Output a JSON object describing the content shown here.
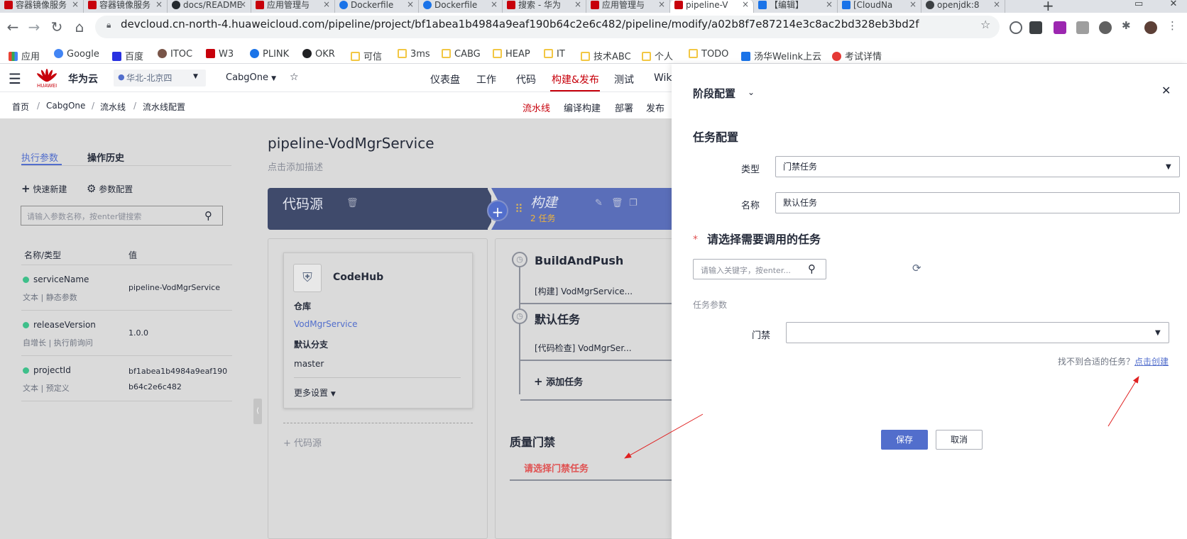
{
  "browser": {
    "tabs": [
      {
        "label": "容器镜像服务",
        "color": "#c7000b"
      },
      {
        "label": "容器镜像服务",
        "color": "#c7000b"
      },
      {
        "label": "docs/README",
        "color": "#24292e"
      },
      {
        "label": "应用管理与",
        "color": "#c7000b"
      },
      {
        "label": "Dockerfile",
        "color": "#1a73e8"
      },
      {
        "label": "Dockerfile",
        "color": "#1a73e8"
      },
      {
        "label": "搜索 - 华为",
        "color": "#c7000b"
      },
      {
        "label": "应用管理与",
        "color": "#c7000b"
      },
      {
        "label": "pipeline-V",
        "color": "#c7000b"
      },
      {
        "label": "【编辑】",
        "color": "#1a73e8"
      },
      {
        "label": "[CloudNa",
        "color": "#1a73e8"
      },
      {
        "label": "openjdk:8",
        "color": "#3c4043"
      }
    ],
    "new_tab": "+",
    "url": "devcloud.cn-north-4.huaweicloud.com/pipeline/project/bf1abea1b4984a9eaf190b64c2e6c482/pipeline/modify/a02b8f7e87214e3c8ac2bd328eb3bd2f",
    "bookmarks": [
      "应用",
      "Google",
      "百度",
      "ITOC",
      "W3",
      "PLINK",
      "OKR",
      "可信",
      "3ms",
      "CABG",
      "HEAP",
      "IT",
      "技术ABC",
      "个人",
      "TODO",
      "汤华Welink上云",
      "考试详情"
    ]
  },
  "header": {
    "brand": "华为云",
    "logo_text": "HUAWEI",
    "region": "华北-北京四",
    "project": "CabgOne",
    "nav": [
      "仪表盘",
      "工作",
      "代码",
      "构建&发布",
      "测试",
      "Wiki"
    ],
    "active_nav": "构建&发布"
  },
  "subheader": {
    "breadcrumb": [
      "首页",
      "CabgOne",
      "流水线",
      "流水线配置"
    ],
    "separator": "/",
    "subnav": [
      "流水线",
      "编译构建",
      "部署",
      "发布"
    ]
  },
  "left_panel": {
    "tabs": [
      "执行参数",
      "操作历史"
    ],
    "actions": [
      "快速新建",
      "参数配置"
    ],
    "search_placeholder": "请输入参数名称，按enter键搜索",
    "columns": [
      "名称/类型",
      "值"
    ],
    "params": [
      {
        "name": "serviceName",
        "type": "文本 | 静态参数",
        "value": "pipeline-VodMgrService",
        "value2": ""
      },
      {
        "name": "releaseVersion",
        "type": "自增长 | 执行前询问",
        "value": "1.0.0",
        "value2": ""
      },
      {
        "name": "projectId",
        "type": "文本 | 预定义",
        "value": "bf1abea1b4984a9eaf190",
        "value2": "b64c2e6c482"
      }
    ]
  },
  "pipeline": {
    "title": "pipeline-VodMgrService",
    "description": "点击添加描述",
    "stage_source": "代码源",
    "stage_build": "构建",
    "stage_build_count": "2 任务",
    "source_card": {
      "title": "CodeHub",
      "repo_label": "仓库",
      "repo": "VodMgrService",
      "branch_label": "默认分支",
      "branch": "master",
      "more": "更多设置"
    },
    "add_source": "+ 代码源",
    "tasks": [
      {
        "name": "BuildAndPush",
        "sub": "[构建] VodMgrService..."
      },
      {
        "name": "默认任务",
        "sub": "[代码检查] VodMgrSer..."
      }
    ],
    "add_task": "添加任务",
    "gate_title": "质量门禁",
    "gate_select": "请选择门禁任务"
  },
  "drawer": {
    "title": "阶段配置",
    "section": "任务配置",
    "type_label": "类型",
    "type_value": "门禁任务",
    "name_label": "名称",
    "name_value": "默认任务",
    "select_title": "请选择需要调用的任务",
    "required_mark": "*",
    "search_placeholder": "请输入关键字，按enter...",
    "params_label": "任务参数",
    "gate_label": "门禁",
    "gate_value": "",
    "help_text": "找不到合适的任务？",
    "help_link": "点击创建",
    "save": "保存",
    "cancel": "取消"
  },
  "colors": {
    "accent": "#526ecc",
    "brand": "#c7000b",
    "danger": "#e05252",
    "success": "#3ebf8a"
  }
}
